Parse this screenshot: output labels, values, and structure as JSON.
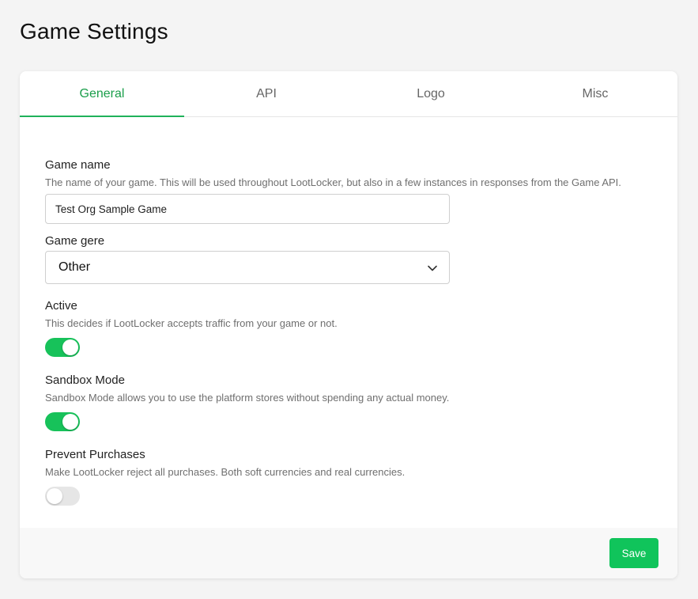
{
  "page": {
    "title": "Game Settings"
  },
  "tabs": [
    {
      "label": "General",
      "active": true
    },
    {
      "label": "API",
      "active": false
    },
    {
      "label": "Logo",
      "active": false
    },
    {
      "label": "Misc",
      "active": false
    }
  ],
  "form": {
    "game_name": {
      "label": "Game name",
      "help": "The name of your game. This will be used throughout LootLocker, but also in a few instances in responses from the Game API.",
      "value": "Test Org Sample Game"
    },
    "game_genre": {
      "label": "Game gere",
      "selected": "Other",
      "icon": "chevron-down-icon"
    },
    "active": {
      "label": "Active",
      "help": "This decides if LootLocker accepts traffic from your game or not.",
      "enabled": true
    },
    "sandbox_mode": {
      "label": "Sandbox Mode",
      "help": "Sandbox Mode allows you to use the platform stores without spending any actual money.",
      "enabled": true
    },
    "prevent_purchases": {
      "label": "Prevent Purchases",
      "help": "Make LootLocker reject all purchases. Both soft currencies and real currencies.",
      "enabled": false
    }
  },
  "footer": {
    "save_label": "Save"
  },
  "colors": {
    "accent": "#10c45b",
    "active_tab": "#1a9e4a",
    "toggle_off": "#e6e6e6"
  }
}
